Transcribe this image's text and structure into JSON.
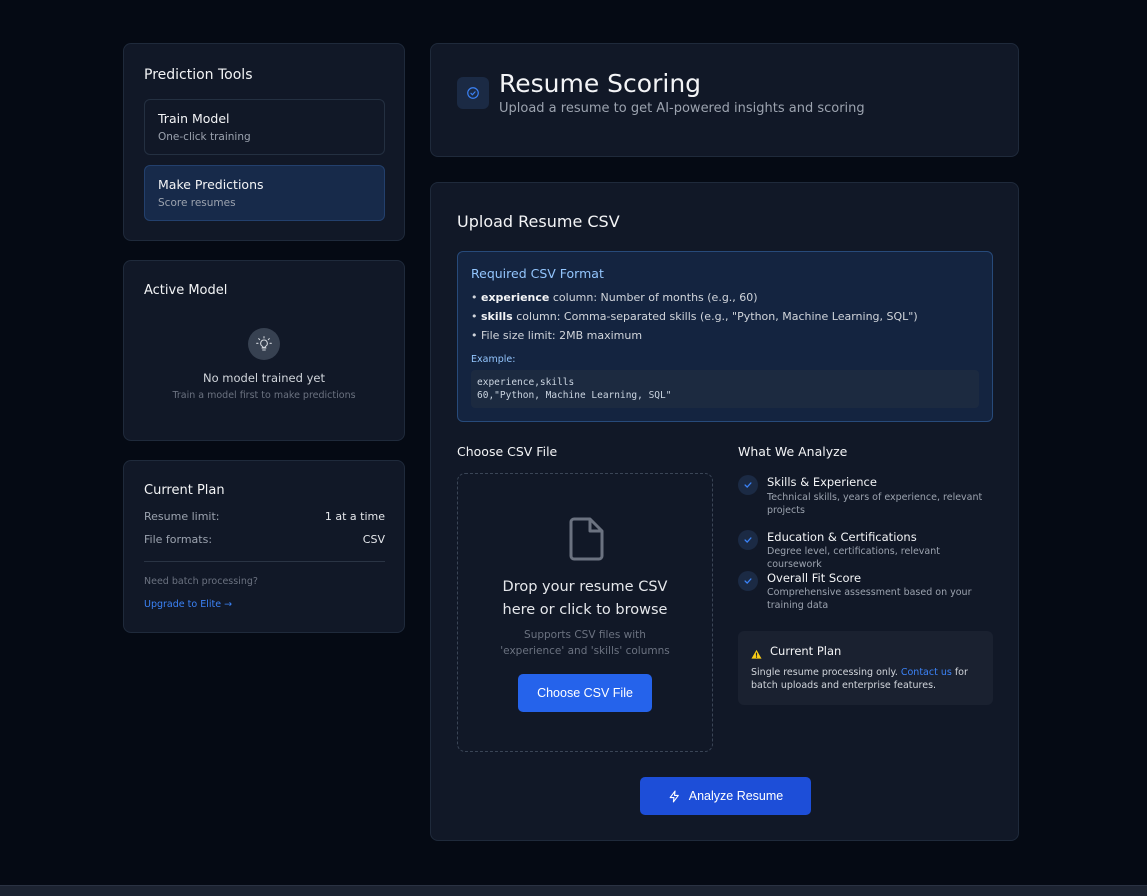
{
  "sidebar": {
    "tools": {
      "title": "Prediction Tools",
      "items": [
        {
          "label": "Train Model",
          "sub": "One-click training"
        },
        {
          "label": "Make Predictions",
          "sub": "Score resumes"
        }
      ]
    },
    "active_model": {
      "title": "Active Model",
      "empty_title": "No model trained yet",
      "empty_sub": "Train a model first to make predictions",
      "icon": "lightbulb-icon"
    },
    "plan": {
      "title": "Current Plan",
      "rows": [
        {
          "label": "Resume limit:",
          "value": "1 at a time"
        },
        {
          "label": "File formats:",
          "value": "CSV"
        }
      ],
      "batch_question": "Need batch processing?",
      "upgrade_link": "Upgrade to Elite →"
    }
  },
  "header": {
    "title": "Resume Scoring",
    "subtitle": "Upload a resume to get AI-powered insights and scoring",
    "icon": "check-circle-icon"
  },
  "upload": {
    "title": "Upload Resume CSV",
    "format": {
      "title": "Required CSV Format",
      "lines": [
        {
          "bold": "experience",
          "text": " column: Number of months (e.g., 60)"
        },
        {
          "bold": "skills",
          "text": " column: Comma-separated skills (e.g., \"Python, Machine Learning, SQL\")"
        },
        {
          "bold": "",
          "text": "File size limit: 2MB maximum"
        }
      ],
      "example_label": "Example:",
      "code_lines": [
        "experience,skills",
        "60,\"Python, Machine Learning, SQL\""
      ]
    },
    "choose_label": "Choose CSV File",
    "dropzone": {
      "line1": "Drop your resume CSV",
      "line2": "here or click to browse",
      "hint1": "Supports CSV files with",
      "hint2": "'experience' and 'skills' columns",
      "button": "Choose CSV File",
      "icon": "file-icon"
    },
    "analyze": {
      "title": "What We Analyze",
      "items": [
        {
          "title": "Skills & Experience",
          "desc": "Technical skills, years of experience, relevant projects"
        },
        {
          "title": "Education & Certifications",
          "desc": "Degree level, certifications, relevant coursework"
        },
        {
          "title": "Overall Fit Score",
          "desc": "Comprehensive assessment based on your training data"
        }
      ]
    },
    "plan_note": {
      "title": "Current Plan",
      "text_before": "Single resume processing only. ",
      "link": "Contact us",
      "text_after": " for batch uploads and enterprise features.",
      "icon": "warning-icon"
    },
    "submit": "Analyze Resume",
    "submit_icon": "lightning-icon"
  },
  "colors": {
    "accent": "#2563eb",
    "background": "#050a14",
    "card": "#111827",
    "warning": "#facc15",
    "link": "#3b82f6"
  }
}
